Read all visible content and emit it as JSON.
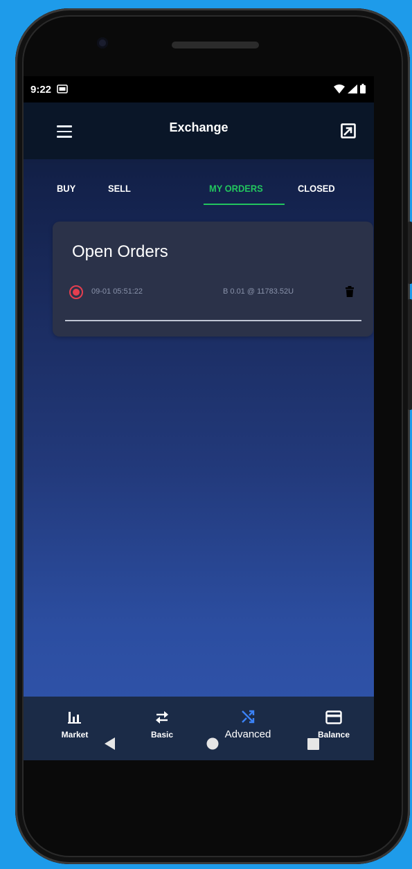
{
  "status_bar": {
    "time": "9:22"
  },
  "app_bar": {
    "title": "Exchange"
  },
  "tabs": [
    {
      "label": "BUY",
      "active": false
    },
    {
      "label": "SELL",
      "active": false
    },
    {
      "label": "MY ORDERS",
      "active": true
    },
    {
      "label": "CLOSED",
      "active": false
    }
  ],
  "open_orders": {
    "title": "Open Orders",
    "orders": [
      {
        "time": "09-01 05:51:22",
        "description": "B 0.01 @ 11783.52U"
      }
    ]
  },
  "bottom_nav": [
    {
      "label": "Market",
      "icon": "bar-chart-icon"
    },
    {
      "label": "Basic",
      "icon": "swap-arrows-icon"
    },
    {
      "label": "Advanced",
      "icon": "shuffle-icon",
      "active": true
    },
    {
      "label": "Balance",
      "icon": "credit-card-icon"
    }
  ],
  "colors": {
    "accent_green": "#22c55e",
    "active_blue": "#3b82f6",
    "order_red": "#e53e4f",
    "card_bg": "#2b3249",
    "app_bar_bg": "#0a1628",
    "bottom_nav_bg": "#1b2b47"
  }
}
